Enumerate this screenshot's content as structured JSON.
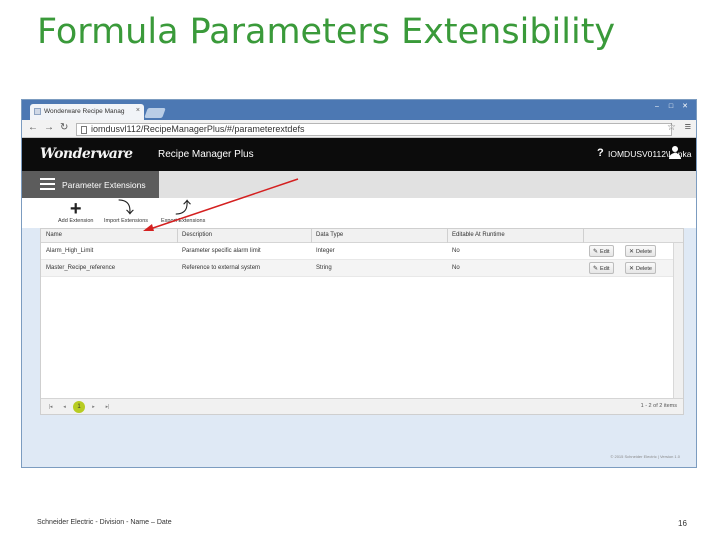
{
  "slide": {
    "title": "Formula Parameters Extensibility",
    "footer": "Schneider Electric - Division - Name – Date",
    "page_number": "16"
  },
  "browser": {
    "tab_title": "Wonderware Recipe Manag",
    "tab_close": "×",
    "url": "iomdusvl112/RecipeManagerPlus/#/parameterextdefs",
    "controls": {
      "minimize": "–",
      "maximize": "□",
      "close": "✕"
    },
    "icons": {
      "back": "arrow-left-icon",
      "forward": "arrow-right-icon",
      "reload": "reload-icon",
      "bookmark": "star-icon",
      "menu": "menu-icon"
    }
  },
  "app": {
    "logo": "Wonderware",
    "title": "Recipe Manager Plus",
    "help": "?",
    "user": "IOMDUSV0112\\Lenka",
    "section": "Parameter Extensions"
  },
  "toolbar": {
    "add_label": "Add Extension",
    "import_label": "Import Extensions",
    "export_label": "Export Extensions"
  },
  "grid": {
    "columns": [
      "Name",
      "Description",
      "Data Type",
      "Editable At Runtime"
    ],
    "rows": [
      {
        "name": "Alarm_High_Limit",
        "description": "Parameter specific alarm limit",
        "data_type": "Integer",
        "editable": "No"
      },
      {
        "name": "Master_Recipe_reference",
        "description": "Reference to external system",
        "data_type": "String",
        "editable": "No"
      }
    ],
    "edit_label": "Edit",
    "delete_label": "Delete",
    "current_page": "1",
    "pager_info": "1 - 2 of 2 items",
    "copyright": "© 2015 Schneider Electric | Version 1.0"
  },
  "colors": {
    "title_green": "#3a9a3a",
    "header_black": "#0c0c0c",
    "section_gray": "#5c5c5c",
    "pager_current": "#b8cc22",
    "annotation_arrow": "#d42020"
  }
}
